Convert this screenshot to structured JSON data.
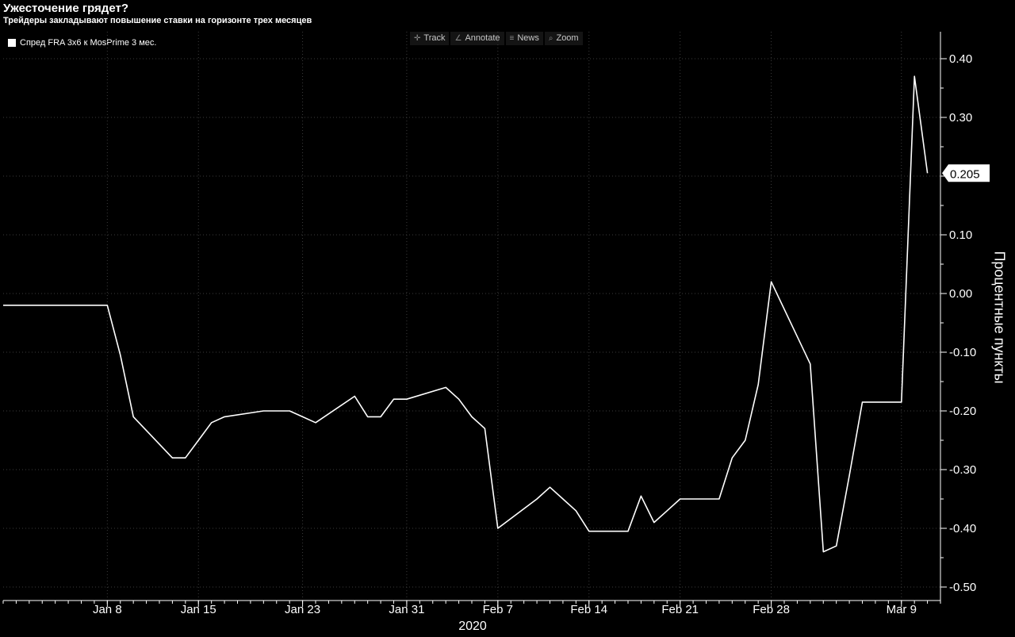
{
  "header": {
    "title": "Ужесточение грядет?",
    "subtitle": "Трейдеры закладывают повышение ставки на горизонте трех месяцев"
  },
  "legend": {
    "label": "Спред FRA 3x6 к MosPrime 3 мес."
  },
  "toolbar": [
    {
      "label": "Track",
      "icon": "crosshair-icon"
    },
    {
      "label": "Annotate",
      "icon": "pencil-icon"
    },
    {
      "label": "News",
      "icon": "list-icon"
    },
    {
      "label": "Zoom",
      "icon": "magnifier-icon"
    }
  ],
  "colors": {
    "background": "#000000",
    "line": "#ffffff",
    "grid": "#3c3c3c"
  },
  "chart_data": {
    "type": "line",
    "title": "Ужесточение грядет?",
    "subtitle": "Трейдеры закладывают повышение ставки на горизонте трех месяцев",
    "ylabel": "Процентные пункты",
    "xlabel": "2020",
    "ylim": [
      -0.52,
      0.45
    ],
    "yticks": [
      0.4,
      0.3,
      0.2,
      0.1,
      0.0,
      -0.1,
      -0.2,
      -0.3,
      -0.4,
      -0.5
    ],
    "ytick_labels": [
      "0.40",
      "0.30",
      "0.20",
      "0.10",
      "0.00",
      "-0.10",
      "-0.20",
      "-0.30",
      "-0.40",
      "-0.50"
    ],
    "grid": true,
    "grid_style": "dotted",
    "y_axis_side": "right",
    "legend_position": "top-left",
    "xlim": [
      "2019-12-31",
      "2020-03-12"
    ],
    "xticks": [
      {
        "date": "2020-01-08",
        "label": "Jan 8"
      },
      {
        "date": "2020-01-15",
        "label": "Jan 15"
      },
      {
        "date": "2020-01-23",
        "label": "Jan 23"
      },
      {
        "date": "2020-01-31",
        "label": "Jan 31"
      },
      {
        "date": "2020-02-07",
        "label": "Feb 7"
      },
      {
        "date": "2020-02-14",
        "label": "Feb 14"
      },
      {
        "date": "2020-02-21",
        "label": "Feb 21"
      },
      {
        "date": "2020-02-28",
        "label": "Feb 28"
      },
      {
        "date": "2020-03-09",
        "label": "Mar 9"
      }
    ],
    "last_value_label": "0.205",
    "series": [
      {
        "name": "Спред FRA 3x6 к MosPrime 3 мес.",
        "color": "#ffffff",
        "x": [
          "2019-12-31",
          "2020-01-08",
          "2020-01-09",
          "2020-01-10",
          "2020-01-13",
          "2020-01-14",
          "2020-01-15",
          "2020-01-16",
          "2020-01-17",
          "2020-01-20",
          "2020-01-21",
          "2020-01-22",
          "2020-01-23",
          "2020-01-24",
          "2020-01-27",
          "2020-01-28",
          "2020-01-29",
          "2020-01-30",
          "2020-01-31",
          "2020-02-03",
          "2020-02-04",
          "2020-02-05",
          "2020-02-06",
          "2020-02-07",
          "2020-02-10",
          "2020-02-11",
          "2020-02-12",
          "2020-02-13",
          "2020-02-14",
          "2020-02-17",
          "2020-02-18",
          "2020-02-19",
          "2020-02-20",
          "2020-02-21",
          "2020-02-24",
          "2020-02-25",
          "2020-02-26",
          "2020-02-27",
          "2020-02-28",
          "2020-03-02",
          "2020-03-03",
          "2020-03-04",
          "2020-03-05",
          "2020-03-06",
          "2020-03-09",
          "2020-03-10",
          "2020-03-11"
        ],
        "y": [
          -0.02,
          -0.02,
          -0.105,
          -0.21,
          -0.28,
          -0.28,
          -0.25,
          -0.22,
          -0.21,
          -0.2,
          -0.2,
          -0.2,
          -0.21,
          -0.22,
          -0.175,
          -0.21,
          -0.21,
          -0.18,
          -0.18,
          -0.16,
          -0.18,
          -0.21,
          -0.23,
          -0.4,
          -0.35,
          -0.33,
          -0.35,
          -0.37,
          -0.405,
          -0.405,
          -0.345,
          -0.39,
          -0.37,
          -0.35,
          -0.35,
          -0.28,
          -0.25,
          -0.155,
          0.02,
          -0.12,
          -0.44,
          -0.43,
          -0.31,
          -0.185,
          -0.185,
          0.37,
          0.205
        ]
      }
    ]
  }
}
